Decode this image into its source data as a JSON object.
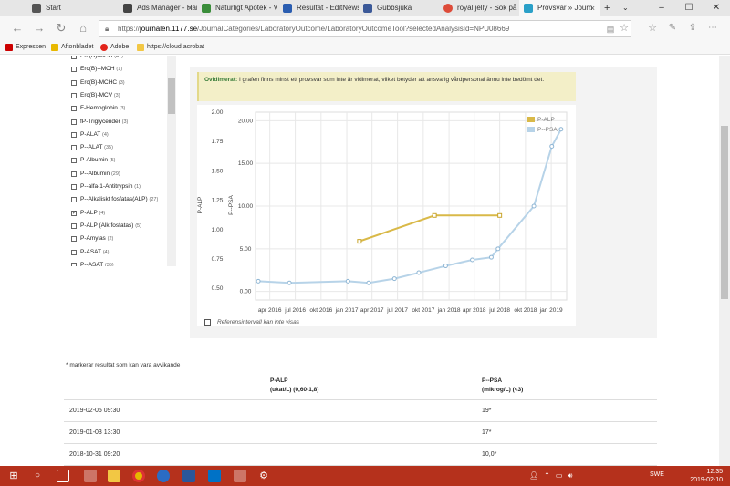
{
  "browser": {
    "tabs": [
      {
        "title": "Start",
        "color": "#555"
      },
      {
        "title": "Ads Manager - Hant",
        "color": "#444"
      },
      {
        "title": "Naturligt Apotek - V",
        "color": "#3a8d3a"
      },
      {
        "title": "Resultat - EditNews",
        "color": "#2a5db0"
      },
      {
        "title": "Gubbsjuka",
        "color": "#3b5998"
      },
      {
        "title": "royal jelly - Sök på G",
        "color": "#dd4b39"
      },
      {
        "title": "Provsvar » Journ",
        "color": "#2aa0c8"
      }
    ],
    "url_prefix": "https://",
    "url_host": "journalen.1177.se",
    "url_path": "/JournalCategories/LaboratoryOutcome/LaboratoryOutcomeTool?selectedAnalysisId=NPU08669",
    "bookmarks": [
      {
        "label": "Expressen",
        "color": "#c00"
      },
      {
        "label": "Aftonbladet",
        "color": "#e8b800"
      },
      {
        "label": "Adobe",
        "color": "#e2231a"
      },
      {
        "label": "https://cloud.acrobat",
        "color": "#f2c744"
      }
    ]
  },
  "analyses": [
    {
      "label": "Erc(B)-MCH",
      "count": "(41)",
      "checked": false
    },
    {
      "label": "Erc(B)--MCH",
      "count": "(1)",
      "checked": false
    },
    {
      "label": "Erc(B)-MCHC",
      "count": "(3)",
      "checked": false
    },
    {
      "label": "Erc(B)-MCV",
      "count": "(3)",
      "checked": false
    },
    {
      "label": "F-Hemoglobin",
      "count": "(3)",
      "checked": false
    },
    {
      "label": "fP-Triglycerider",
      "count": "(3)",
      "checked": false
    },
    {
      "label": "P-ALAT",
      "count": "(4)",
      "checked": false
    },
    {
      "label": "P--ALAT",
      "count": "(35)",
      "checked": false
    },
    {
      "label": "P-Albumin",
      "count": "(5)",
      "checked": false
    },
    {
      "label": "P--Albumin",
      "count": "(29)",
      "checked": false
    },
    {
      "label": "P--alfa-1-Antitrypsin",
      "count": "(1)",
      "checked": false
    },
    {
      "label": "P--Alkaliskt fosfatas(ALP)",
      "count": "(27)",
      "checked": false
    },
    {
      "label": "P-ALP",
      "count": "(4)",
      "checked": true
    },
    {
      "label": "P-ALP (Alk fosfatas)",
      "count": "(5)",
      "checked": false
    },
    {
      "label": "P-Amylas",
      "count": "(2)",
      "checked": false
    },
    {
      "label": "P-ASAT",
      "count": "(4)",
      "checked": false
    },
    {
      "label": "P--ASAT",
      "count": "(35)",
      "checked": false
    }
  ],
  "warning": {
    "label": "Ovidimerat:",
    "text": "I grafen finns minst ett provsvar som inte är vidimerat, vilket betyder att ansvarig vårdpersonal ännu inte bedömt det."
  },
  "chart_data": {
    "type": "line",
    "x_ticks": [
      "apr 2016",
      "jul 2016",
      "okt 2016",
      "jan 2017",
      "apr 2017",
      "jul 2017",
      "okt 2017",
      "jan 2018",
      "apr 2018",
      "jul 2018",
      "okt 2018",
      "jan 2019"
    ],
    "y_left_label": "P-ALP",
    "y_left_ticks": [
      "0.50",
      "0.75",
      "1.00",
      "1.25",
      "1.50",
      "1.75",
      "2.00"
    ],
    "y_left_lim": [
      0.4,
      2.0
    ],
    "y_right_label": "P--PSA",
    "y_right_ticks": [
      "0.00",
      "5.00",
      "10.00",
      "15.00",
      "20.00"
    ],
    "y_right_lim": [
      -1.0,
      21.0
    ],
    "legend_position": "top-right",
    "series": [
      {
        "name": "P-ALP",
        "axis": "left",
        "color": "#d9b948",
        "x": [
          "2017-02-15",
          "2017-11-10",
          "2018-07-01"
        ],
        "y": [
          0.9,
          1.12,
          1.12
        ]
      },
      {
        "name": "P--PSA",
        "axis": "right",
        "color": "#b7d3e8",
        "x": [
          "2016-02-20",
          "2016-06-10",
          "2017-01-05",
          "2017-03-20",
          "2017-06-20",
          "2017-09-15",
          "2017-12-20",
          "2018-03-25",
          "2018-06-01",
          "2018-06-25",
          "2018-10-31",
          "2019-01-03",
          "2019-02-05"
        ],
        "y": [
          1.2,
          1.0,
          1.2,
          1.0,
          1.5,
          2.2,
          3.0,
          3.7,
          4.0,
          5.0,
          10.0,
          17.0,
          19.0
        ]
      }
    ]
  },
  "reference_label": "Referensintervall kan inte visas",
  "footnote": "* markerar resultat som kan vara avvikande",
  "table": {
    "col1_header_line1": "P-ALP",
    "col1_header_line2": "(ukat/L) (0,60-1,8)",
    "col2_header_line1": "P--PSA",
    "col2_header_line2": "(mikrog/L) (<3)",
    "rows": [
      {
        "date": "2019-02-05 09:30",
        "alp": "",
        "psa": "19*"
      },
      {
        "date": "2019-01-03 13:30",
        "alp": "",
        "psa": "17*"
      },
      {
        "date": "2018-10-31 09:20",
        "alp": "",
        "psa": "10,0*"
      }
    ]
  },
  "taskbar": {
    "language": "SWE",
    "time": "12:35",
    "date": "2019-02-10"
  }
}
